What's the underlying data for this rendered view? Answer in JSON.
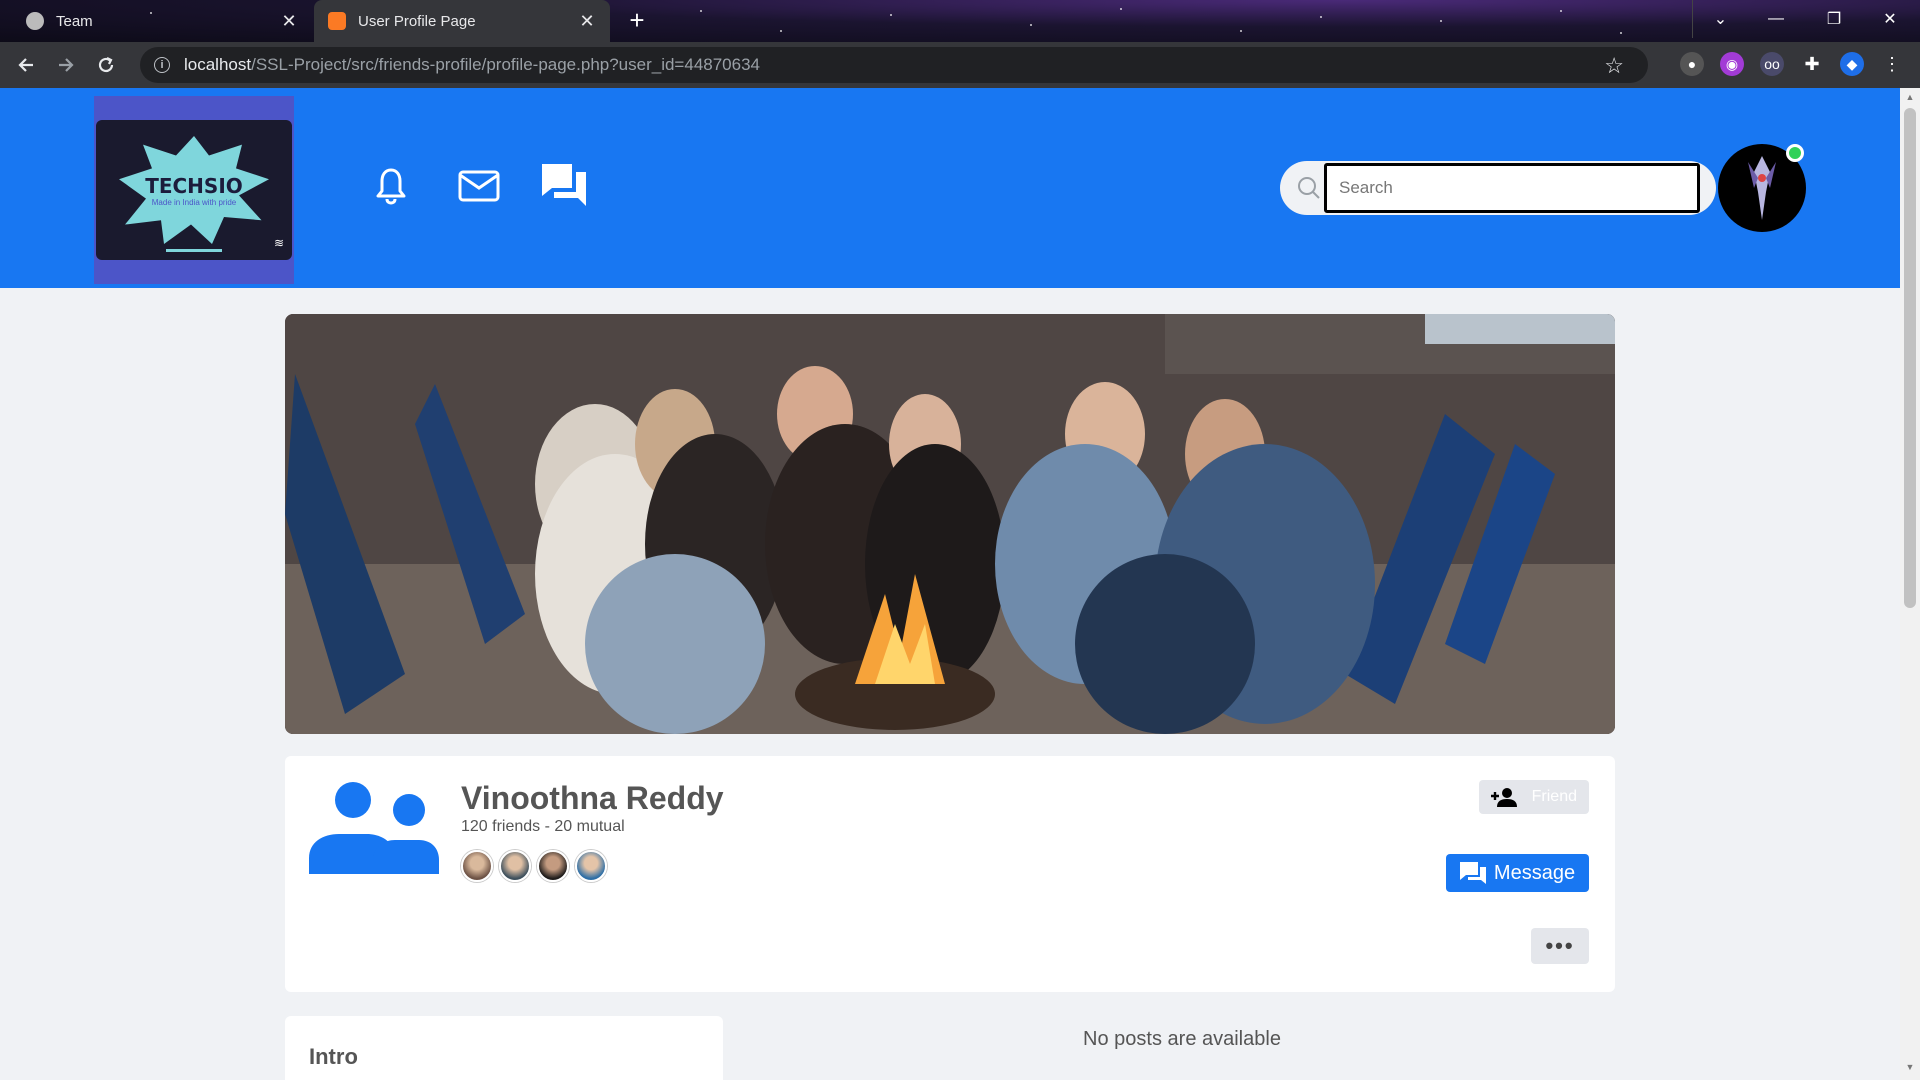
{
  "browser": {
    "tabs": [
      {
        "title": "Team",
        "active": false
      },
      {
        "title": "User Profile Page",
        "active": true
      }
    ],
    "url": {
      "host": "localhost",
      "path": "/SSL-Project/src/friends-profile/profile-page.php?user_id=44870634"
    }
  },
  "header": {
    "logo": {
      "title": "TECHSIO",
      "subtitle": "Made in India with pride"
    },
    "icons": [
      "bell-icon",
      "mail-icon",
      "chat-icon"
    ],
    "search": {
      "placeholder": "Search",
      "value": ""
    },
    "user_online": true,
    "color": "#1877f2"
  },
  "profile": {
    "name": "Vinoothna Reddy",
    "friends_text": "120 friends - 20 mutual",
    "mutual_friend_avatars": 4,
    "friend_button": "Friend",
    "message_button": "Message",
    "more_button": "•••"
  },
  "intro": {
    "title": "Intro"
  },
  "posts": {
    "empty_text": "No posts are available"
  }
}
